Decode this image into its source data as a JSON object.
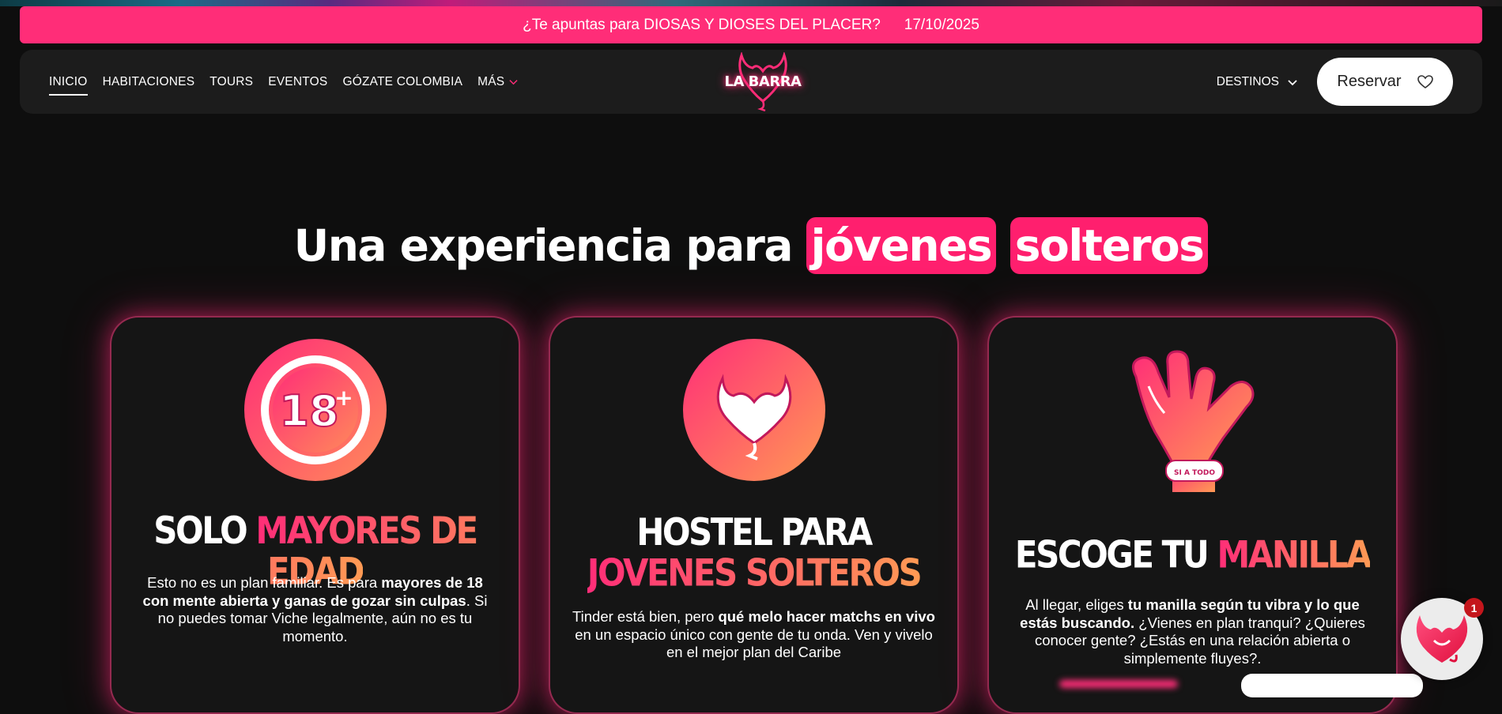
{
  "announcement": {
    "text": "¿Te apuntas para DIOSAS Y DIOSES DEL PLACER?",
    "date": "17/10/2025"
  },
  "nav": {
    "items": [
      {
        "label": "INICIO",
        "active": true
      },
      {
        "label": "HABITACIONES"
      },
      {
        "label": "TOURS"
      },
      {
        "label": "EVENTOS"
      },
      {
        "label": "GÓZATE COLOMBIA"
      },
      {
        "label": "MÁS"
      }
    ],
    "logo_text": "LA BARRA",
    "destinos": "DESTINOS",
    "reservar": "Reservar"
  },
  "headline": {
    "prefix": "Una experiencia para",
    "word1": "jóvenes",
    "word2": "solteros"
  },
  "cards": [
    {
      "icon": "eighteen-plus-icon",
      "title_white": "SOLO",
      "title_accent": "MAYORES DE EDAD",
      "text_a": "Esto no es un plan familiar. Es para ",
      "text_b": "mayores de 18 con mente abierta y ganas de gozar sin culpas",
      "text_c": ". Si no puedes tomar Viche legalmente, aún no es tu momento."
    },
    {
      "icon": "devil-heart-icon",
      "title_white": "HOSTEL PARA",
      "title_accent": "JOVENES SOLTEROS",
      "text_a": "Tinder está bien, pero ",
      "text_b": "qué melo hacer matchs en vivo",
      "text_c": " en un espacio único con gente de tu onda. Ven y vivelo en el mejor plan del Caribe"
    },
    {
      "icon": "hang-loose-hand-icon",
      "band_text": "SI A TODO",
      "title_white": "ESCOGE TU",
      "title_accent": "MANILLA",
      "text_a": "Al llegar, eliges ",
      "text_b": "tu manilla según tu vibra y lo que estás buscando.",
      "text_c": " ¿Vienes en plan tranqui? ¿Quieres conocer gente? ¿Estás en una relación abierta o simplemente fluyes?."
    }
  ],
  "chat": {
    "badge_count": "1"
  },
  "colors": {
    "brand_pink": "#ff2d78",
    "accent_orange": "#ff9a54",
    "background": "#0e0e0e"
  }
}
